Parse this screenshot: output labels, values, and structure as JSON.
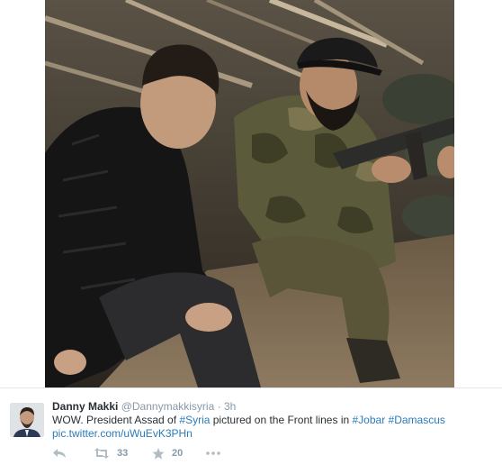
{
  "tweet": {
    "fullname": "Danny Makki",
    "username": "@Dannymakkisyria",
    "separator": "·",
    "time": "3h",
    "text_part1": "WOW. President Assad of ",
    "hashtag_syria": "#Syria",
    "text_part2": " pictured on the Front lines in ",
    "hashtag_jobar": "#Jobar",
    "text_space": " ",
    "hashtag_damascus": "#Damascus",
    "media_link": "pic.twitter.com/uWuEvK3PHn"
  },
  "actions": {
    "reply_icon": "reply-icon",
    "retweet_icon": "retweet-icon",
    "retweet_count": "33",
    "favorite_icon": "star-icon",
    "favorite_count": "20",
    "more_icon": "more-icon"
  },
  "colors": {
    "text": "#292f33",
    "muted": "#8899a6",
    "link": "#2b7bb9",
    "divider": "#e1e8ed",
    "icon": "#b1bbc3"
  }
}
